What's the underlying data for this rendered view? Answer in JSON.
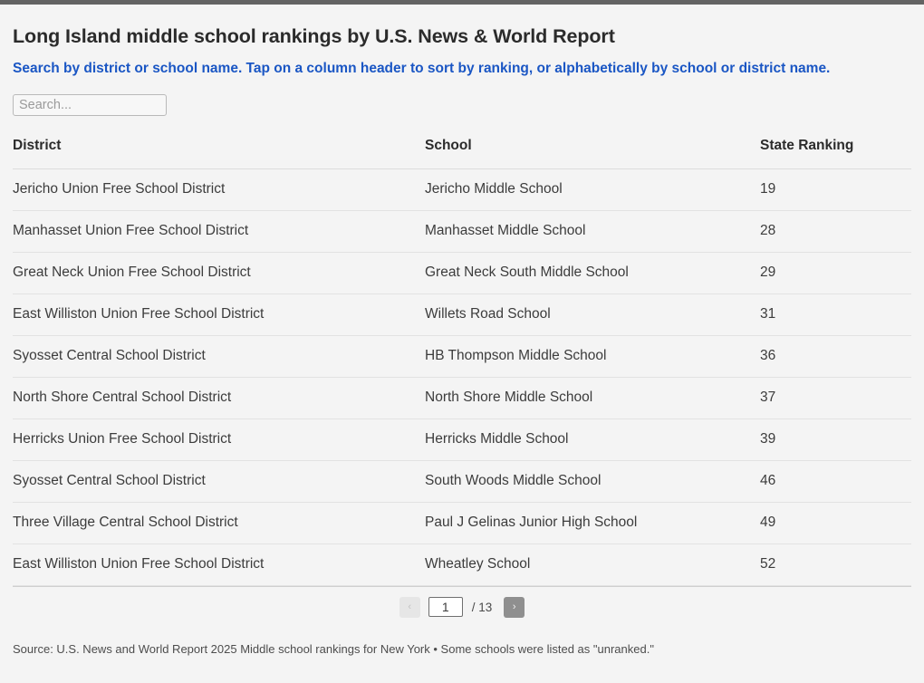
{
  "top_bar": {
    "color": "#636363"
  },
  "header": {
    "title": "Long Island middle school rankings by U.S. News & World Report",
    "subtitle": "Search by district or school name. Tap on a column header to sort by ranking, or alphabetically by school or district name.",
    "subtitle_color": "#1a56c4"
  },
  "search": {
    "value": "",
    "placeholder": "Search..."
  },
  "table": {
    "columns": [
      {
        "key": "district",
        "label": "District"
      },
      {
        "key": "school",
        "label": "School"
      },
      {
        "key": "rank",
        "label": "State Ranking"
      }
    ],
    "rows": [
      {
        "district": "Jericho Union Free School District",
        "school": "Jericho Middle School",
        "rank": "19"
      },
      {
        "district": "Manhasset Union Free School District",
        "school": "Manhasset Middle School",
        "rank": "28"
      },
      {
        "district": "Great Neck Union Free School District",
        "school": "Great Neck South Middle School",
        "rank": "29"
      },
      {
        "district": "East Williston Union Free School District",
        "school": "Willets Road School",
        "rank": "31"
      },
      {
        "district": "Syosset Central School District",
        "school": "HB Thompson Middle School",
        "rank": "36"
      },
      {
        "district": "North Shore Central School District",
        "school": "North Shore Middle School",
        "rank": "37"
      },
      {
        "district": "Herricks Union Free School District",
        "school": "Herricks Middle School",
        "rank": "39"
      },
      {
        "district": "Syosset Central School District",
        "school": "South Woods Middle School",
        "rank": "46"
      },
      {
        "district": "Three Village Central School District",
        "school": "Paul J Gelinas Junior High School",
        "rank": "49"
      },
      {
        "district": "East Williston Union Free School District",
        "school": "Wheatley School",
        "rank": "52"
      }
    ]
  },
  "pagination": {
    "prev_label": "‹",
    "next_label": "›",
    "current_page": "1",
    "total_label": "/ 13"
  },
  "footer": {
    "source": "Source: U.S. News and World Report 2025 Middle school rankings for New York • Some schools were listed as \"unranked.\""
  }
}
